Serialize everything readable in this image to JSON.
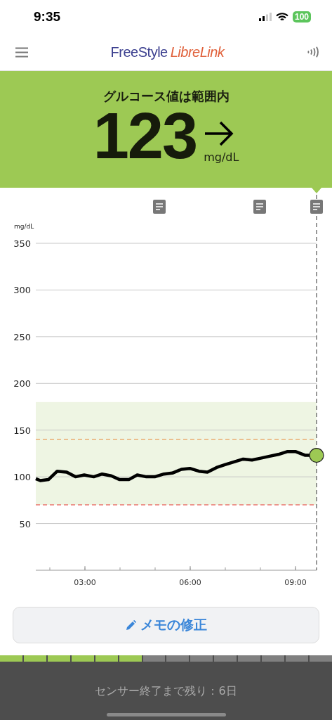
{
  "status_bar": {
    "time": "9:35",
    "battery": "100"
  },
  "header": {
    "logo_part_1": "FreeStyle",
    "logo_part_2": "LibreLink"
  },
  "reading": {
    "status": "グルコース値は範囲内",
    "value": "123",
    "unit": "mg/dL"
  },
  "chart": {
    "chart_data": {
      "type": "line",
      "ylabel": "mg/dL",
      "xlim": [
        1.6,
        9.6
      ],
      "ylim": [
        0,
        350
      ],
      "yticks": [
        50,
        100,
        150,
        200,
        250,
        300,
        350
      ],
      "xticks": [
        {
          "value": 3,
          "label": "03:00"
        },
        {
          "value": 6,
          "label": "06:00"
        },
        {
          "value": 9,
          "label": "09:00"
        }
      ],
      "x": [
        1.6,
        1.73,
        1.96,
        2.21,
        2.48,
        2.73,
        2.98,
        3.25,
        3.49,
        3.75,
        3.99,
        4.25,
        4.49,
        4.75,
        4.99,
        5.25,
        5.49,
        5.75,
        5.99,
        6.25,
        6.49,
        6.75,
        6.99,
        7.25,
        7.51,
        7.76,
        8.01,
        8.26,
        8.51,
        8.76,
        9.01,
        9.28,
        9.58
      ],
      "grid": true,
      "series": [
        {
          "color": "#000000",
          "values": [
            98,
            96,
            97,
            106,
            105,
            100,
            102,
            100,
            103,
            101,
            97,
            97,
            102,
            100,
            100,
            103,
            104,
            108,
            109,
            106,
            105,
            110,
            113,
            116,
            119,
            118,
            120,
            122,
            124,
            127,
            127,
            123,
            123
          ]
        }
      ],
      "bands": [
        {
          "axis": "y",
          "from": 70,
          "to": 180,
          "color": "#eef5e3"
        }
      ],
      "ref_lines": [
        {
          "axis": "y",
          "value": 140,
          "color": "#e8893a"
        },
        {
          "axis": "y",
          "value": 70,
          "color": "#e53935"
        }
      ]
    }
  },
  "edit_button": {
    "label": "メモの修正"
  },
  "sensor": {
    "segments": [
      {
        "used": true
      },
      {
        "used": true
      },
      {
        "used": true
      },
      {
        "used": true
      },
      {
        "used": true
      },
      {
        "used": true
      },
      {
        "used": false
      },
      {
        "used": false
      },
      {
        "used": false
      },
      {
        "used": false
      },
      {
        "used": false
      },
      {
        "used": false
      },
      {
        "used": false
      },
      {
        "used": false
      }
    ],
    "remaining": "センサー終了まで残り：6日"
  }
}
